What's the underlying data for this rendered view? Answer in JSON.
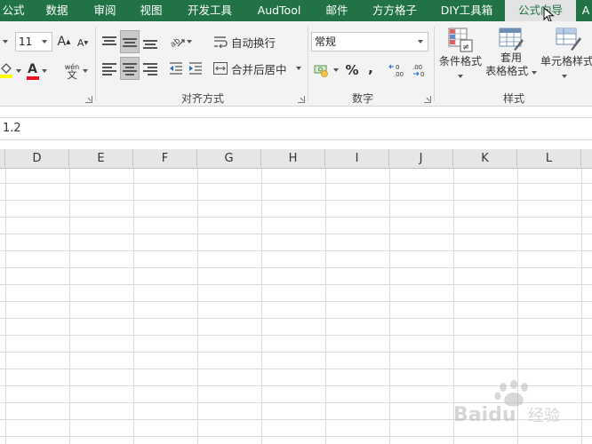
{
  "ribbon_tabs": [
    {
      "label": "公式",
      "active": false
    },
    {
      "label": "数据",
      "active": false
    },
    {
      "label": "审阅",
      "active": false
    },
    {
      "label": "视图",
      "active": false
    },
    {
      "label": "开发工具",
      "active": false
    },
    {
      "label": "AudTool",
      "active": false
    },
    {
      "label": "邮件",
      "active": false
    },
    {
      "label": "方方格子",
      "active": false
    },
    {
      "label": "DIY工具箱",
      "active": false
    },
    {
      "label": "公式向导",
      "active": true
    },
    {
      "label": "A",
      "active": false
    }
  ],
  "font_group": {
    "font_size": "11",
    "grow_font": "A",
    "shrink_font": "A",
    "font_color_glyph": "A",
    "phonetic_glyph": "wén"
  },
  "alignment_group": {
    "label": "对齐方式",
    "wrap_text": "自动换行",
    "merge_center": "合并后居中"
  },
  "number_group": {
    "label": "数字",
    "format_value": "常规",
    "percent": "%",
    "comma": ",",
    "increase_decimal": "←0 .00",
    "decrease_decimal": ".00 →0"
  },
  "styles_group": {
    "label": "样式",
    "conditional_format": "条件格式",
    "table_format_line1": "套用",
    "table_format_line2": "表格格式",
    "cell_styles": "单元格样式"
  },
  "formula_bar": {
    "content": "1.2"
  },
  "columns": [
    "D",
    "E",
    "F",
    "G",
    "H",
    "I",
    "J",
    "K",
    "L"
  ],
  "watermark": {
    "brand": "Baidu",
    "text": "经验"
  },
  "colors": {
    "ribbon_green": "#217346",
    "font_color_red": "#e81123",
    "fill_yellow": "#ffff00"
  }
}
